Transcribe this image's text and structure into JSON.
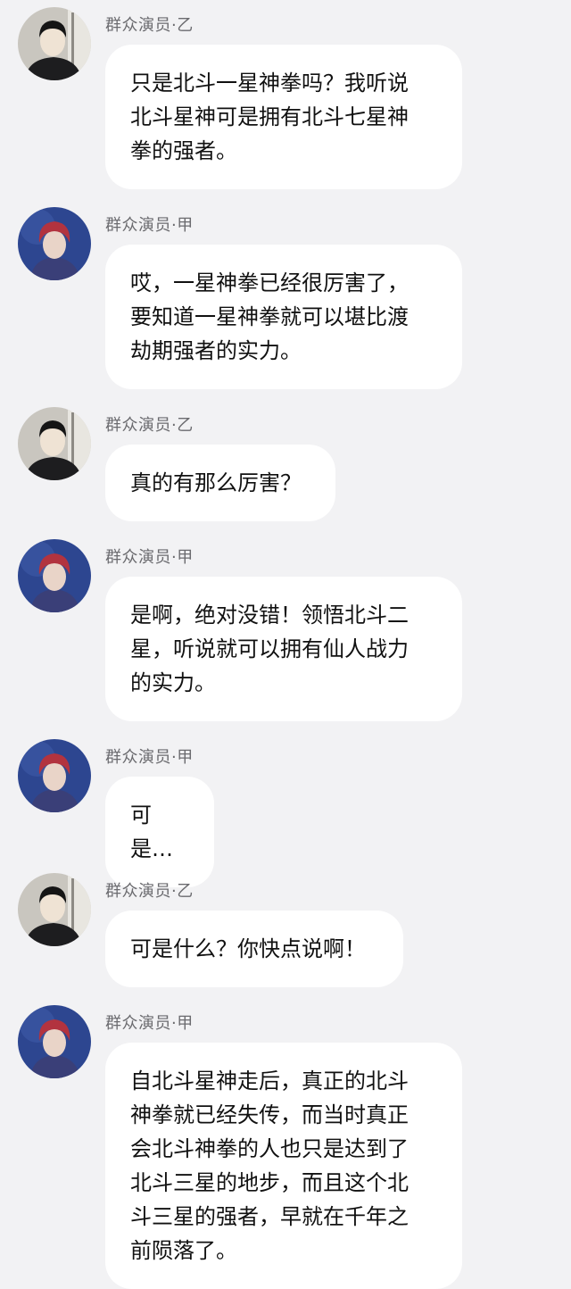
{
  "colors": {
    "background": "#f2f2f4",
    "bubble": "#ffffff",
    "name_text": "#6b6b6f",
    "message_text": "#111111"
  },
  "messages": [
    {
      "sender": "群众演员·乙",
      "avatar": "dark-haired-student-avatar",
      "text": "只是北斗一星神拳吗？我听说\n北斗星神可是拥有北斗七星神\n拳的强者。"
    },
    {
      "sender": "群众演员·甲",
      "avatar": "red-haired-boy-avatar",
      "text": "哎，一星神拳已经很厉害了，\n要知道一星神拳就可以堪比渡\n劫期强者的实力。"
    },
    {
      "sender": "群众演员·乙",
      "avatar": "dark-haired-student-avatar",
      "text": "真的有那么厉害？"
    },
    {
      "sender": "群众演员·甲",
      "avatar": "red-haired-boy-avatar",
      "text": "是啊，绝对没错！领悟北斗二\n星，听说就可以拥有仙人战力\n的实力。"
    },
    {
      "sender": "群众演员·甲",
      "avatar": "red-haired-boy-avatar",
      "text": "可是…"
    },
    {
      "sender": "群众演员·乙",
      "avatar": "dark-haired-student-avatar",
      "text": "可是什么？你快点说啊！"
    },
    {
      "sender": "群众演员·甲",
      "avatar": "red-haired-boy-avatar",
      "text": "自北斗星神走后，真正的北斗\n神拳就已经失传，而当时真正\n会北斗神拳的人也只是达到了\n北斗三星的地步，而且这个北\n斗三星的强者，早就在千年之\n前陨落了。"
    }
  ]
}
